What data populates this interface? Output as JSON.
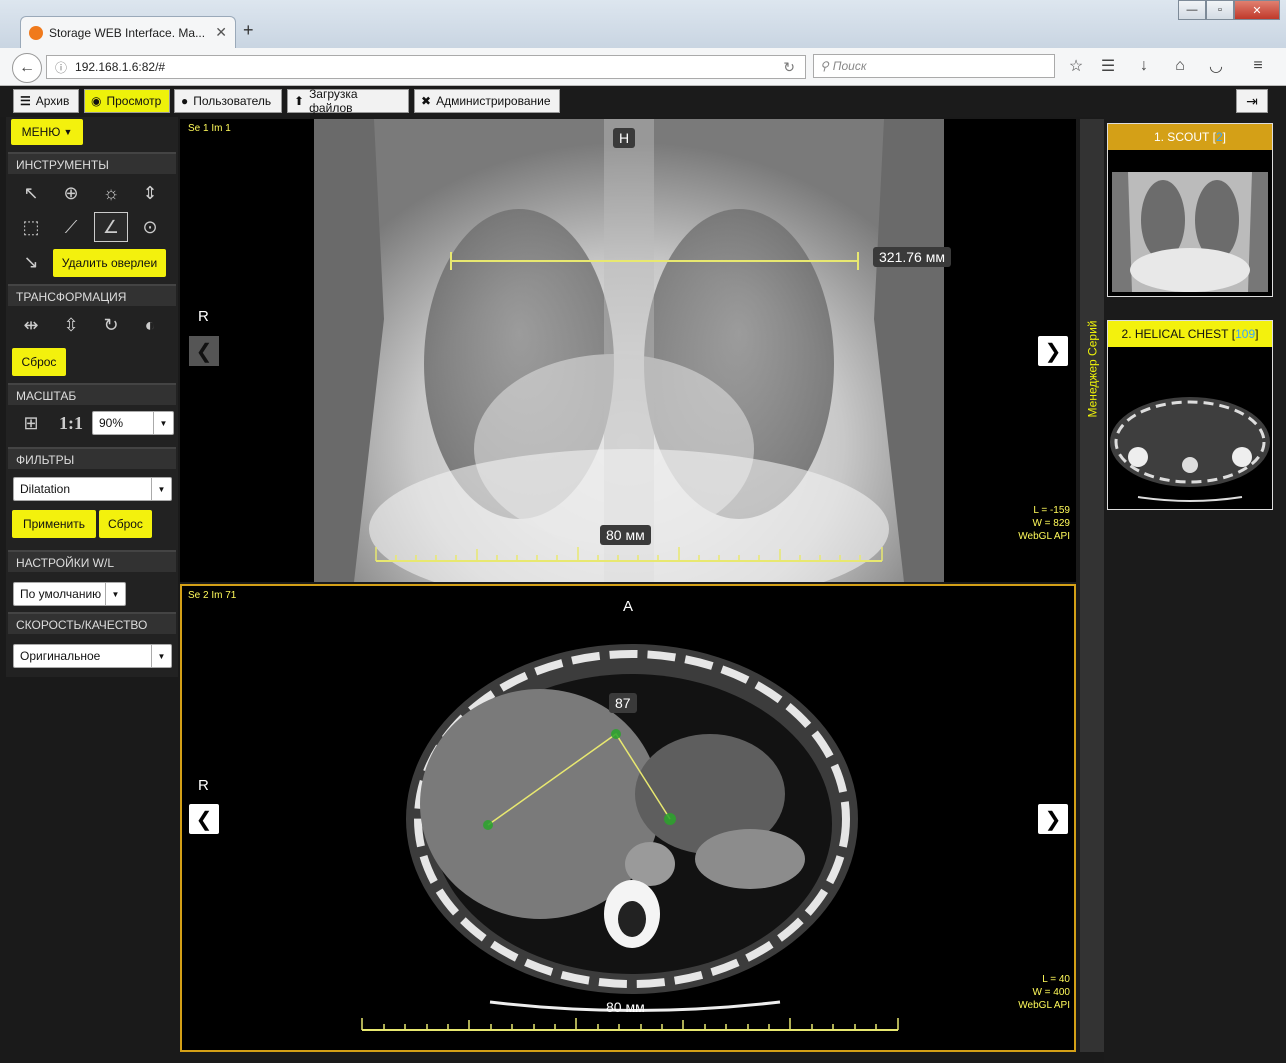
{
  "browser": {
    "tab_title": "Storage WEB Interface. Ma...",
    "new_tab": "+",
    "url": "192.168.1.6:82/#",
    "search_placeholder": "Поиск"
  },
  "app_menu": {
    "archive": "Архив",
    "view": "Просмотр",
    "user": "Пользователь",
    "upload": "Загрузка файлов",
    "admin": "Администрирование"
  },
  "left": {
    "menu_button": "МЕНЮ",
    "tools_header": "ИНСТРУМЕНТЫ",
    "delete_overlay": "Удалить оверлеи",
    "transform_header": "ТРАНСФОРМАЦИЯ",
    "reset": "Сброс",
    "scale_header": "МАСШТАБ",
    "scale_one": "1:1",
    "zoom_value": "90%",
    "filters_header": "ФИЛЬТРЫ",
    "filter_value": "Dilatation",
    "apply": "Применить",
    "filter_reset": "Сброс",
    "wl_header": "НАСТРОЙКИ W/L",
    "wl_value": "По умолчанию",
    "quality_header": "СКОРОСТЬ/КАЧЕСТВО",
    "quality_value": "Оригинальное"
  },
  "viewport_top": {
    "series_image": "Se 1 Im 1",
    "orientation_top": "H",
    "orientation_left": "R",
    "measurement": "321.76 мм",
    "scale_label": "80 мм",
    "wl_level": "L = -159",
    "wl_width": "W = 829",
    "renderer": "WebGL API"
  },
  "viewport_bottom": {
    "series_image": "Se 2 Im 71",
    "orientation_top": "A",
    "orientation_left": "R",
    "angle": "87",
    "scale_label": "80 мм",
    "wl_level": "L = 40",
    "wl_width": "W = 400",
    "renderer": "WebGL API"
  },
  "series_manager": {
    "label": "Менеджер Серий",
    "items": [
      {
        "title": "1. SCOUT",
        "count": "2"
      },
      {
        "title": "2. HELICAL CHEST",
        "count": "109"
      }
    ]
  }
}
